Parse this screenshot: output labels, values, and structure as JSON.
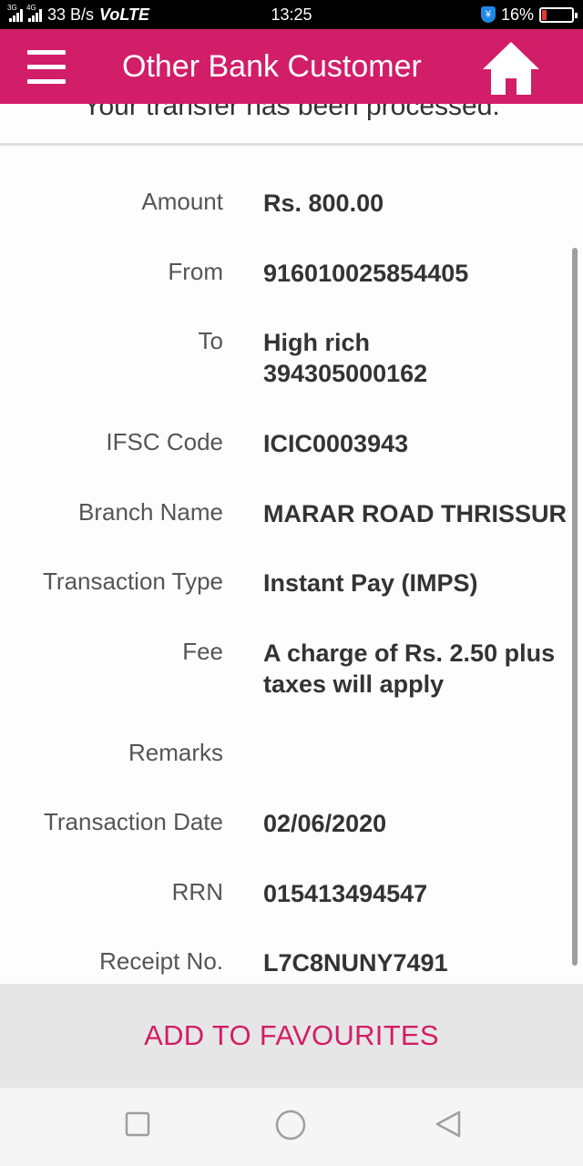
{
  "status_bar": {
    "network_tag_1": "3G",
    "network_tag_2": "4G",
    "speed": "33 B/s",
    "volte": "VoLTE",
    "time": "13:25",
    "battery": "16%",
    "battery_level": 0.16
  },
  "app_bar": {
    "title": "Other Bank Customer"
  },
  "message": "Your transfer has been processed.",
  "details": [
    {
      "label": "Amount",
      "value": "Rs. 800.00"
    },
    {
      "label": "From",
      "value": "916010025854405"
    },
    {
      "label": "To",
      "value": "High rich",
      "value_line2": "394305000162"
    },
    {
      "label": "IFSC Code",
      "value": "ICIC0003943"
    },
    {
      "label": "Branch Name",
      "value": "MARAR ROAD THRISSUR"
    },
    {
      "label": "Transaction Type",
      "value": "Instant Pay (IMPS)"
    },
    {
      "label": "Fee",
      "value": "A charge of Rs. 2.50 plus",
      "value_line2": "taxes will apply"
    },
    {
      "label": "Remarks",
      "value": ""
    },
    {
      "label": "Transaction Date",
      "value": "02/06/2020"
    },
    {
      "label": "RRN",
      "value": "015413494547"
    },
    {
      "label": "Receipt No.",
      "value": "L7C8NUNY7491"
    }
  ],
  "actions": {
    "add_to_favourites": "ADD TO FAVOURITES"
  },
  "colors": {
    "brand": "#d21d68",
    "status_bar": "#000000"
  },
  "icons": {
    "menu": "hamburger-menu-icon",
    "home": "home-icon",
    "nav_recent": "square-icon",
    "nav_home": "circle-icon",
    "nav_back": "triangle-back-icon"
  }
}
